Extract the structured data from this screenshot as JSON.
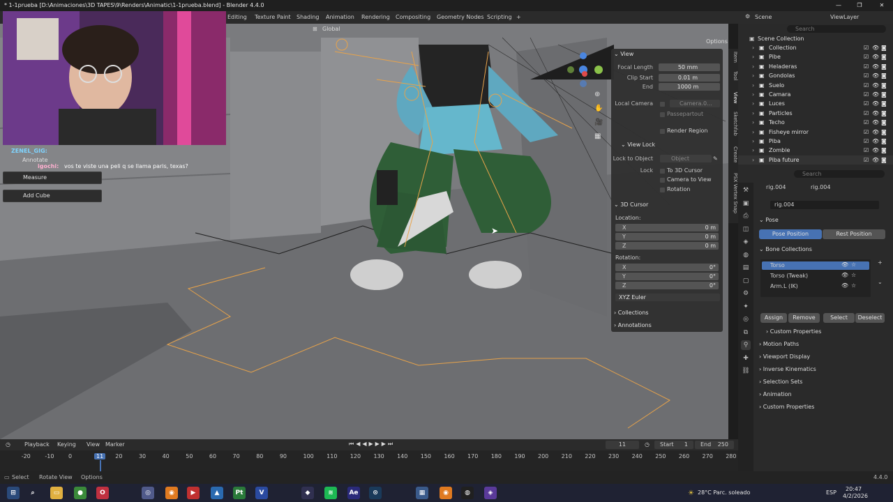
{
  "window": {
    "title": "* 1-1prueba [D:\\Animaciones\\3D TAPES\\9\\Renders\\Animatic\\1-1prueba.blend] - Blender 4.4.0",
    "controls": [
      "—",
      "❐",
      "✕"
    ]
  },
  "workspaces": [
    "Editing",
    "Texture Paint",
    "Shading",
    "Animation",
    "Rendering",
    "Compositing",
    "Geometry Nodes",
    "Scripting"
  ],
  "workspace_add": "+",
  "scene": {
    "label": "Scene",
    "viewlayer": "ViewLayer"
  },
  "viewport_header": {
    "orientation": "Global",
    "options": "Options"
  },
  "chat": {
    "user1": "ZENEL_GIG:",
    "user2": "igochi:",
    "message": "vos te viste una peli q se llama paris, texas?"
  },
  "tools": {
    "annotate": "Annotate",
    "measure": "Measure",
    "add_cube": "Add Cube"
  },
  "npanel": {
    "view_title": "View",
    "focal_length_label": "Focal Length",
    "focal_length": "50 mm",
    "clip_start_label": "Clip Start",
    "clip_start": "0.01 m",
    "end_label": "End",
    "clip_end": "1000 m",
    "local_camera_label": "Local Camera",
    "local_camera": "Camera.0...",
    "passepartout": "Passepartout",
    "render_region": "Render Region",
    "view_lock_title": "View Lock",
    "lock_to_object_label": "Lock to Object",
    "lock_object_placeholder": "Object",
    "lock_label": "Lock",
    "to_3d_cursor": "To 3D Cursor",
    "camera_to_view": "Camera to View",
    "rotation_check": "Rotation",
    "cursor_title": "3D Cursor",
    "location_label": "Location:",
    "loc_x": "0 m",
    "loc_y": "0 m",
    "loc_z": "0 m",
    "rotation_label": "Rotation:",
    "rot_x": "0°",
    "rot_y": "0°",
    "rot_z": "0°",
    "x": "X",
    "y": "Y",
    "z": "Z",
    "rotation_mode": "XYZ Euler",
    "collections": "Collections",
    "annotations": "Annotations"
  },
  "side_tabs": [
    "Item",
    "Tool",
    "View",
    "Sketchfab",
    "Create",
    "PSX Vertex Snap"
  ],
  "outliner": {
    "search_placeholder": "Search",
    "root": "Scene Collection",
    "items": [
      "Collection",
      "Pibe",
      "Heladeras",
      "Gondolas",
      "Suelo",
      "Camara",
      "Luces",
      "Particles",
      "Techo",
      "Fisheye mirror",
      "Piba",
      "Zombie",
      "Piba future"
    ]
  },
  "properties": {
    "search_placeholder": "Search",
    "breadcrumb_object": "rig.004",
    "breadcrumb_data": "rig.004",
    "data_name": "rig.004",
    "pose_section": "Pose",
    "pose_position": "Pose Position",
    "rest_position": "Rest Position",
    "bone_collections": "Bone Collections",
    "bone_items": [
      "Torso",
      "Torso (Tweak)",
      "Arm.L (IK)"
    ],
    "assign": "Assign",
    "remove": "Remove",
    "select": "Select",
    "deselect": "Deselect",
    "custom_props_inner": "Custom Properties",
    "sections": [
      "Motion Paths",
      "Viewport Display",
      "Inverse Kinematics",
      "Selection Sets",
      "Animation",
      "Custom Properties"
    ]
  },
  "timeline": {
    "menus": [
      "Playback",
      "Keying",
      "View",
      "Marker"
    ],
    "current_frame": "11",
    "start_label": "Start",
    "start": "1",
    "end_label": "End",
    "end": "250",
    "ticks": [
      "-20",
      "-10",
      "0",
      "11",
      "20",
      "30",
      "40",
      "50",
      "60",
      "70",
      "80",
      "90",
      "100",
      "110",
      "120",
      "130",
      "140",
      "150",
      "160",
      "170",
      "180",
      "190",
      "200",
      "210",
      "220",
      "230",
      "240",
      "250",
      "260",
      "270",
      "280"
    ]
  },
  "status": {
    "select": "Select",
    "rotate_view": "Rotate View",
    "options": "Options",
    "version": "4.4.0"
  },
  "taskbar": {
    "weather": "28°C  Parc. soleado",
    "lang": "ESP",
    "time": "20:47",
    "date": "4/2/2026"
  },
  "colors": {
    "accent": "#4772b3",
    "orange": "#e8a34a",
    "viewport": "#7c7d80"
  }
}
